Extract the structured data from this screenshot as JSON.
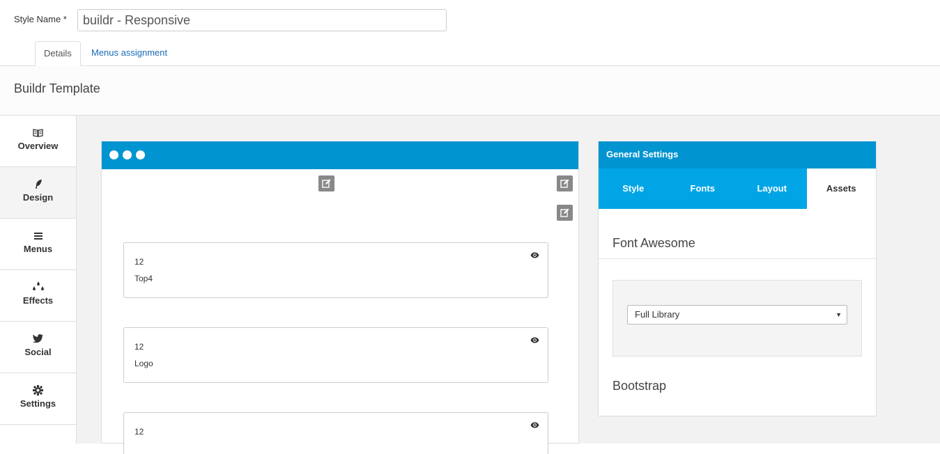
{
  "style_name": {
    "label": "Style Name *",
    "value": "buildr - Responsive"
  },
  "tabs": [
    {
      "label": "Details",
      "active": true
    },
    {
      "label": "Menus assignment",
      "active": false
    }
  ],
  "template_title": "Buildr Template",
  "sidebar": {
    "items": [
      {
        "label": "Overview",
        "icon": "book-icon",
        "active": false
      },
      {
        "label": "Design",
        "icon": "feather-icon",
        "active": true
      },
      {
        "label": "Menus",
        "icon": "bars-icon",
        "active": false
      },
      {
        "label": "Effects",
        "icon": "drops-icon",
        "active": false
      },
      {
        "label": "Social",
        "icon": "twitter-icon",
        "active": false
      },
      {
        "label": "Settings",
        "icon": "gear-icon",
        "active": false
      }
    ]
  },
  "builder": {
    "rows": [
      {
        "width": "12",
        "name": "Top4"
      },
      {
        "width": "12",
        "name": "Logo"
      },
      {
        "width": "12",
        "name": ""
      }
    ]
  },
  "settings": {
    "header": "General Settings",
    "tabs": [
      {
        "label": "Style",
        "active": false
      },
      {
        "label": "Fonts",
        "active": false
      },
      {
        "label": "Layout",
        "active": false
      },
      {
        "label": "Assets",
        "active": true
      }
    ],
    "font_awesome_title": "Font Awesome",
    "font_awesome_select": "Full Library",
    "bootstrap_title": "Bootstrap"
  },
  "colors": {
    "accent": "#0094d0",
    "tab_bar": "#00a5e6",
    "link": "#1a6bb8"
  }
}
